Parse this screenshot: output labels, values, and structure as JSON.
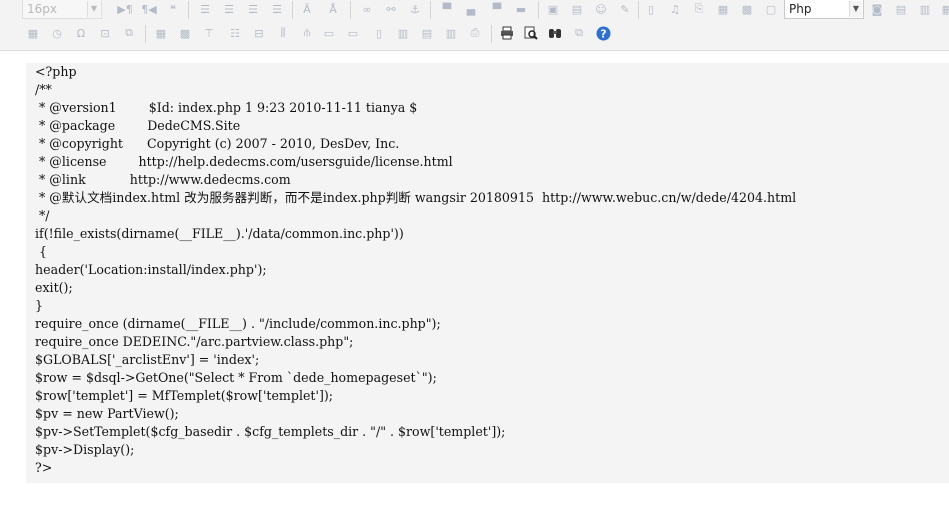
{
  "toolbar": {
    "font_size_value": "16px",
    "language_value": "Php",
    "icons_row1": [
      "ltr-icon",
      "rtl-icon",
      "blockquote-icon",
      "align-left-icon",
      "align-center-icon",
      "align-right-icon",
      "align-justify-icon",
      "clear-format-icon",
      "font-case-icon",
      "link-icon",
      "unlink-icon",
      "anchor-icon",
      "table-row-a-icon",
      "table-row-b-icon",
      "table-row-c-icon",
      "table-row-d-icon",
      "image-icon",
      "gallery-icon",
      "emoticon-icon",
      "scrawl-icon",
      "attachment-icon",
      "music-icon",
      "file-link-icon",
      "map-icon",
      "gmap-icon",
      "flash-icon"
    ],
    "icons_row1_right": [
      "snapscreen-icon",
      "wordimage-icon",
      "insert-frame-icon",
      "page-break-icon"
    ],
    "icons_row2": [
      "date-icon",
      "time-icon",
      "omega-icon",
      "spechars-icon",
      "template-icon",
      "insert-table-icon",
      "delete-table-icon",
      "insert-paragraph-before-icon",
      "insert-row-icon",
      "delete-row-icon",
      "insert-col-icon",
      "delete-col-icon",
      "merge-cells-icon",
      "merge-right-icon",
      "merge-down-icon",
      "split-cells-icon",
      "split-rows-icon",
      "split-cols-icon",
      "paste-text-icon",
      "print-icon",
      "preview-icon",
      "search-replace-icon",
      "drafts-icon",
      "help-icon"
    ]
  },
  "editor": {
    "code_lines": [
      "<?php",
      "/**",
      " * @version1        $Id: index.php 1 9:23 2010-11-11 tianya $",
      " * @package        DedeCMS.Site",
      " * @copyright      Copyright (c) 2007 - 2010, DesDev, Inc.",
      " * @license        http://help.dedecms.com/usersguide/license.html",
      " * @link           http://www.dedecms.com",
      " * @默认文档index.html 改为服务器判断，而不是index.php判断 wangsir 20180915  http://www.webuc.cn/w/dede/4204.html",
      " */",
      "if(!file_exists(dirname(__FILE__).'/data/common.inc.php'))",
      " {",
      "header('Location:install/index.php');",
      "exit();",
      "}",
      "require_once (dirname(__FILE__) . \"/include/common.inc.php\");",
      "require_once DEDEINC.\"/arc.partview.class.php\";",
      "$GLOBALS['_arclistEnv'] = 'index';",
      "$row = $dsql->GetOne(\"Select * From `dede_homepageset`\");",
      "$row['templet'] = MfTemplet($row['templet']);",
      "$pv = new PartView();",
      "$pv->SetTemplet($cfg_basedir . $cfg_templets_dir . \"/\" . $row['templet']);",
      "$pv->Display();",
      "?>"
    ]
  },
  "colors": {
    "toolbar_bg": "#f3f3f3",
    "editor_bg": "#f4f4f4",
    "help_blue": "#2f6fd1",
    "icon_gray": "#7f8fa6"
  }
}
